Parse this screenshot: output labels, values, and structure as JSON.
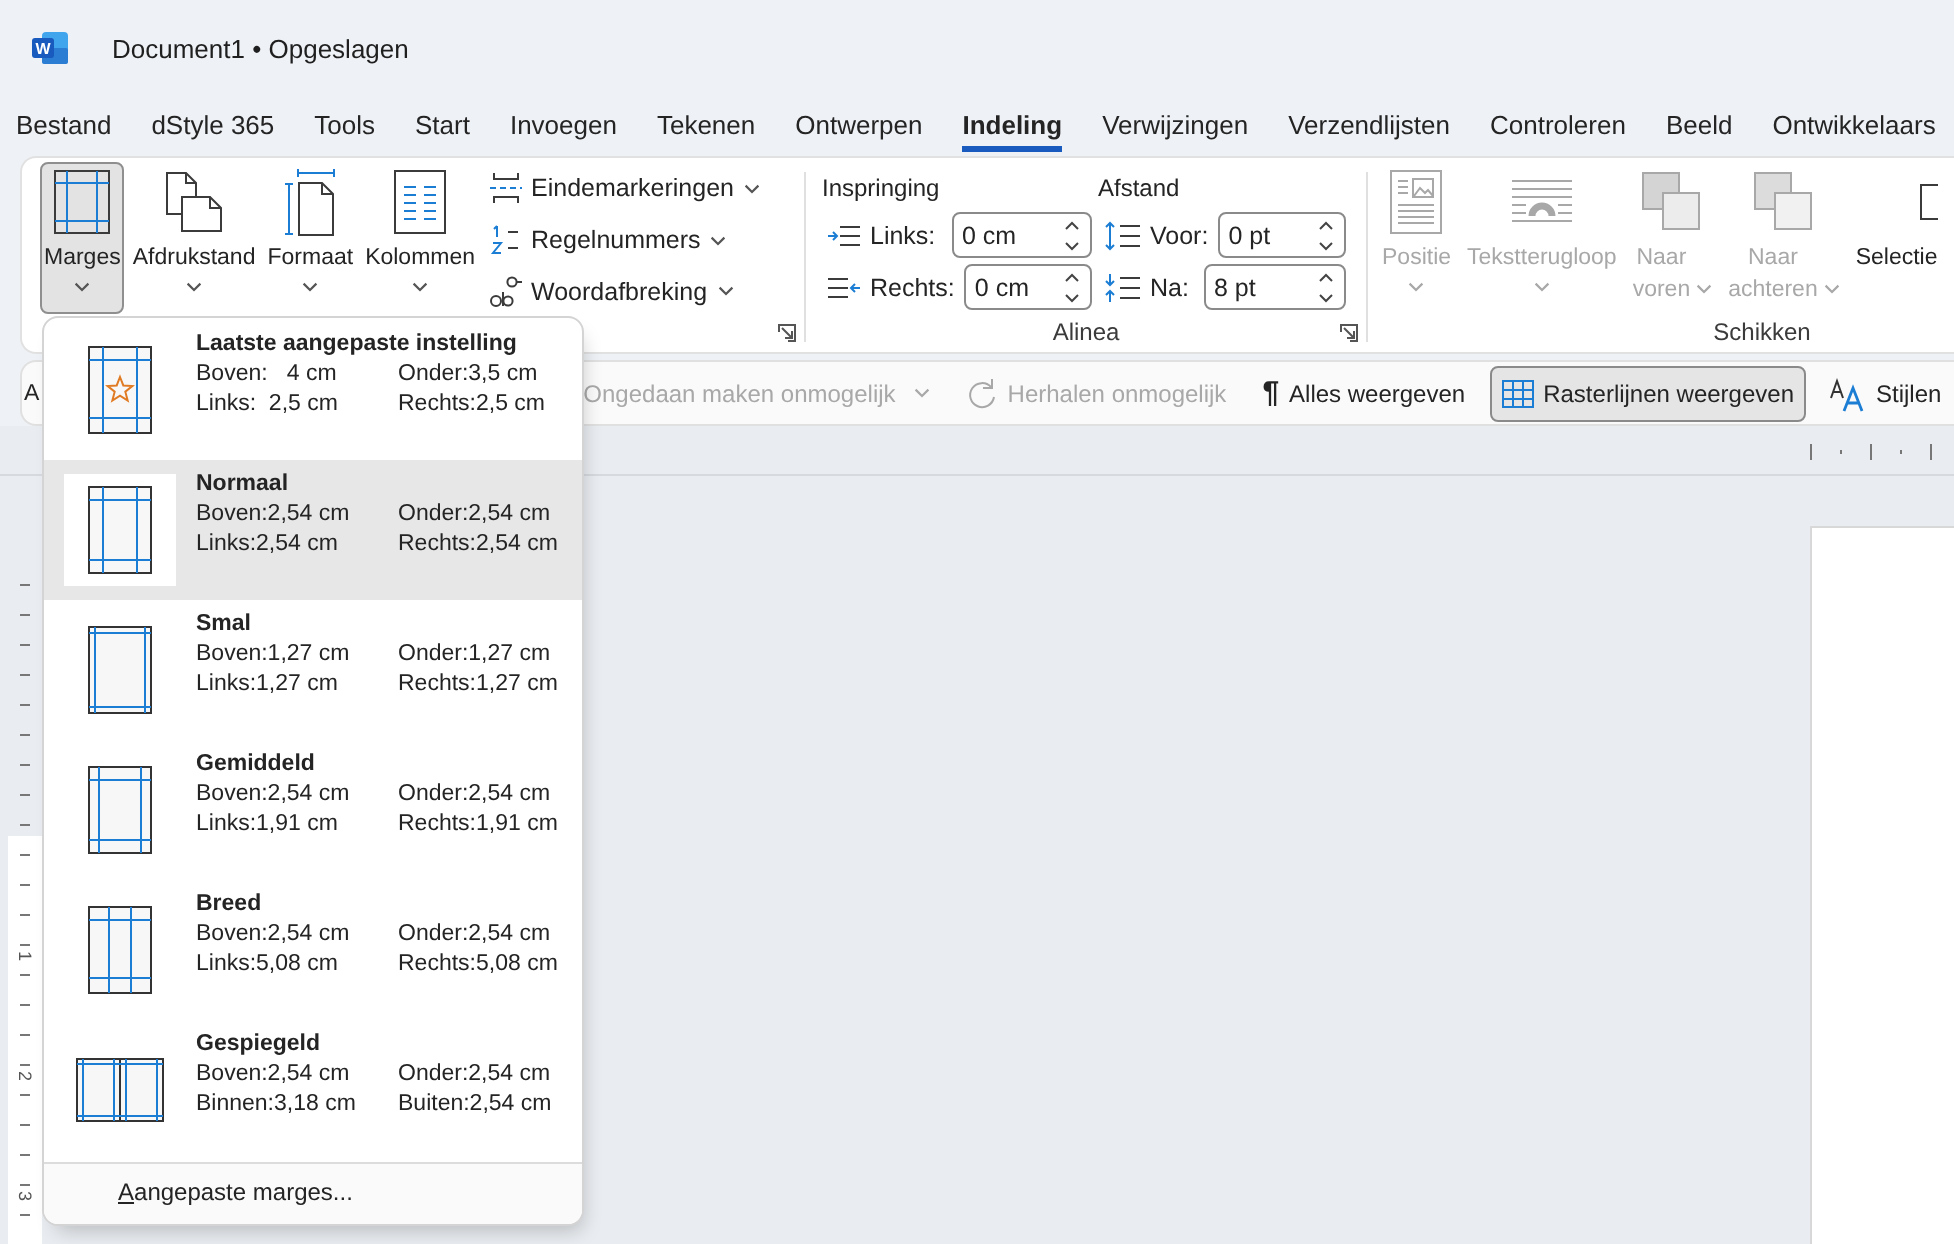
{
  "window": {
    "logo_letter": "W",
    "title": "Document1 • Opgeslagen"
  },
  "tabs": [
    {
      "label": "Bestand",
      "selected": false
    },
    {
      "label": "dStyle 365",
      "selected": false
    },
    {
      "label": "Tools",
      "selected": false
    },
    {
      "label": "Start",
      "selected": false
    },
    {
      "label": "Invoegen",
      "selected": false
    },
    {
      "label": "Tekenen",
      "selected": false
    },
    {
      "label": "Ontwerpen",
      "selected": false
    },
    {
      "label": "Indeling",
      "selected": true
    },
    {
      "label": "Verwijzingen",
      "selected": false
    },
    {
      "label": "Verzendlijsten",
      "selected": false
    },
    {
      "label": "Controleren",
      "selected": false
    },
    {
      "label": "Beeld",
      "selected": false
    },
    {
      "label": "Ontwikkelaars",
      "selected": false
    }
  ],
  "page_setup": {
    "large_buttons": [
      {
        "kind": "margins",
        "label": "Marges",
        "pressed": true
      },
      {
        "kind": "orientation",
        "label": "Afdrukstand",
        "pressed": false
      },
      {
        "kind": "size",
        "label": "Formaat",
        "pressed": false
      },
      {
        "kind": "columns",
        "label": "Kolommen",
        "pressed": false
      }
    ],
    "small_buttons": [
      {
        "kind": "breaks",
        "label": "Eindemarkeringen"
      },
      {
        "kind": "line_numbers",
        "label": "Regelnummers"
      },
      {
        "kind": "hyphenation",
        "label": "Woordafbreking"
      }
    ]
  },
  "paragraph": {
    "title": "Alinea",
    "indent_heading": "Inspringing",
    "spacing_heading": "Afstand",
    "indent_fields": [
      {
        "kind": "left",
        "label": "Links:",
        "value": "0 cm"
      },
      {
        "kind": "right",
        "label": "Rechts:",
        "value": "0 cm"
      }
    ],
    "spacing_fields": [
      {
        "kind": "before",
        "label": "Voor:",
        "value": "0 pt"
      },
      {
        "kind": "after",
        "label": "Na:",
        "value": "8 pt"
      }
    ]
  },
  "arrange": {
    "title": "Schikken",
    "buttons": [
      {
        "kind": "position",
        "label": "Positie",
        "disabled": true
      },
      {
        "kind": "wrap",
        "label": "Tekstterugloop",
        "disabled": true
      },
      {
        "kind": "forward",
        "label": "Naar voren",
        "disabled": true
      },
      {
        "kind": "backward",
        "label": "Naar achteren",
        "disabled": true
      },
      {
        "kind": "selection",
        "label": "Selectie",
        "disabled": false
      }
    ]
  },
  "quick_toolbar": {
    "cut_label": "A",
    "items": [
      {
        "kind": "undo",
        "label": "Ongedaan maken onmogelijk",
        "disabled": true,
        "pressed": false
      },
      {
        "kind": "redo",
        "label": "Herhalen onmogelijk",
        "disabled": true,
        "pressed": false
      },
      {
        "kind": "show_marks",
        "glyph": "¶",
        "label": "Alles weergeven",
        "disabled": false,
        "pressed": false
      },
      {
        "kind": "gridlines",
        "label": "Rasterlijnen weergeven",
        "disabled": false,
        "pressed": true
      },
      {
        "kind": "styles",
        "label": "Stijlen",
        "disabled": false,
        "pressed": false
      }
    ]
  },
  "vertical_ruler": {
    "numbers": [
      "1",
      "2",
      "3"
    ]
  },
  "margins_menu": {
    "items": [
      {
        "kind": "last_custom",
        "title": "Laatste aangepaste instelling",
        "selected": false,
        "values": [
          "Boven:   4 cm",
          "Onder:3,5 cm",
          "Links:  2,5 cm",
          "Rechts:2,5 cm"
        ]
      },
      {
        "kind": "normal",
        "title": "Normaal",
        "selected": true,
        "values": [
          "Boven:2,54 cm",
          "Onder:2,54 cm",
          "Links:2,54 cm",
          "Rechts:2,54 cm"
        ]
      },
      {
        "kind": "narrow",
        "title": "Smal",
        "selected": false,
        "values": [
          "Boven:1,27 cm",
          "Onder:1,27 cm",
          "Links:1,27 cm",
          "Rechts:1,27 cm"
        ]
      },
      {
        "kind": "moderate",
        "title": "Gemiddeld",
        "selected": false,
        "values": [
          "Boven:2,54 cm",
          "Onder:2,54 cm",
          "Links:1,91 cm",
          "Rechts:1,91 cm"
        ]
      },
      {
        "kind": "wide",
        "title": "Breed",
        "selected": false,
        "values": [
          "Boven:2,54 cm",
          "Onder:2,54 cm",
          "Links:5,08 cm",
          "Rechts:5,08 cm"
        ]
      },
      {
        "kind": "mirrored",
        "title": "Gespiegeld",
        "selected": false,
        "values": [
          "Boven:2,54 cm",
          "Onder:2,54 cm",
          "Binnen:3,18 cm",
          "Buiten:2,54 cm"
        ]
      }
    ],
    "footer": {
      "label": "Aangepaste marges...",
      "mnemonic_underlined": true
    }
  }
}
